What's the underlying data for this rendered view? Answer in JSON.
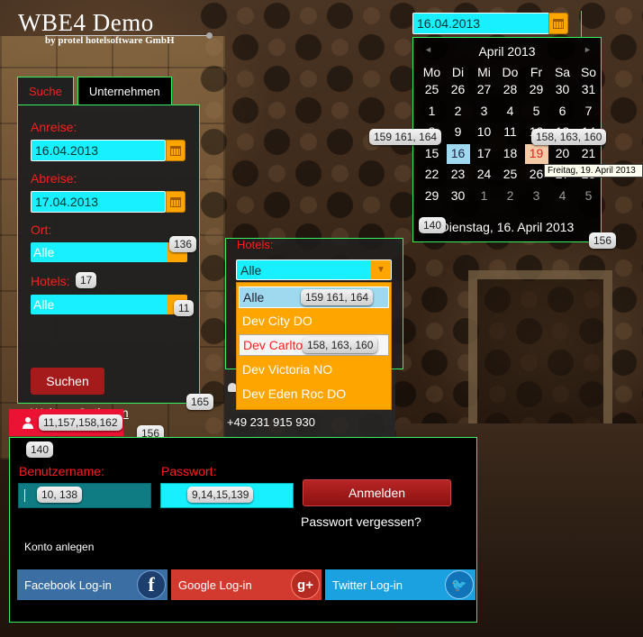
{
  "logo": {
    "title": "WBE4 Demo",
    "subtitle": "by protel hotelsoftware GmbH"
  },
  "search": {
    "tabs": [
      {
        "label": "Suche"
      },
      {
        "label": "Unternehmen"
      }
    ],
    "anreise_label": "Anreise:",
    "anreise_value": "16.04.2013",
    "abreise_label": "Abreise:",
    "abreise_value": "17.04.2013",
    "ort_label": "Ort:",
    "ort_value": "Alle",
    "hotels_label": "Hotels:",
    "hotels_value": "Alle",
    "submit_label": "Suchen",
    "more_options": "Weitere Optionen"
  },
  "hotels_dropdown": {
    "label": "Hotels:",
    "selected": "Alle",
    "options": [
      "Alle",
      "Dev City DO",
      "Dev Carlton",
      "Dev Victoria NO",
      "Dev Eden Roc DO"
    ]
  },
  "contact": {
    "phone": "+49 231 915 930"
  },
  "datepicker": {
    "input_value": "16.04.2013",
    "month_title": "April 2013",
    "prev": "◄",
    "next": "►",
    "weekdays": [
      "Mo",
      "Di",
      "Mi",
      "Do",
      "Fr",
      "Sa",
      "So"
    ],
    "weeks": [
      [
        "25",
        "26",
        "27",
        "28",
        "29",
        "30",
        "31"
      ],
      [
        "1",
        "2",
        "3",
        "4",
        "5",
        "6",
        "7"
      ],
      [
        "8",
        "9",
        "10",
        "11",
        "12",
        "13",
        "14"
      ],
      [
        "15",
        "16",
        "17",
        "18",
        "19",
        "20",
        "21"
      ],
      [
        "22",
        "23",
        "24",
        "25",
        "26",
        "27",
        "28"
      ],
      [
        "29",
        "30",
        "1",
        "2",
        "3",
        "4",
        "5"
      ]
    ],
    "footer": "Dienstag, 16. April 2013",
    "tooltip": "Freitag, 19. April 2013"
  },
  "login": {
    "username_label": "Benutzername:",
    "password_label": "Passwort:",
    "submit_label": "Anmelden",
    "forgot": "Passwort vergessen?",
    "create_account": "Konto anlegen",
    "social": [
      {
        "label": "Facebook Log-in",
        "glyph": "f"
      },
      {
        "label": "Google Log-in",
        "glyph": "g+"
      },
      {
        "label": "Twitter Log-in",
        "glyph": "🐦"
      }
    ]
  },
  "badges": {
    "ort": "136",
    "hotels_label": "17",
    "hotels_select": "11",
    "panel": "165",
    "user_tab": "11,157,158,162",
    "user_tab_side": "156",
    "login_corner": "140",
    "username_field": "10, 138",
    "password_field": "9,14,15,139",
    "dp_today": "159 161, 164",
    "dp_selected": "158, 163, 160",
    "dp_footer": "140",
    "dp_corner": "156",
    "opt_alle": "159 161, 164",
    "opt_carlton": "158, 163, 160"
  },
  "colors": {
    "accent_green": "#38f060",
    "input_cyan": "#18f0ff",
    "label_red": "#ff1d1d",
    "orange": "#ffa500",
    "button_red": "#a51a1a"
  }
}
